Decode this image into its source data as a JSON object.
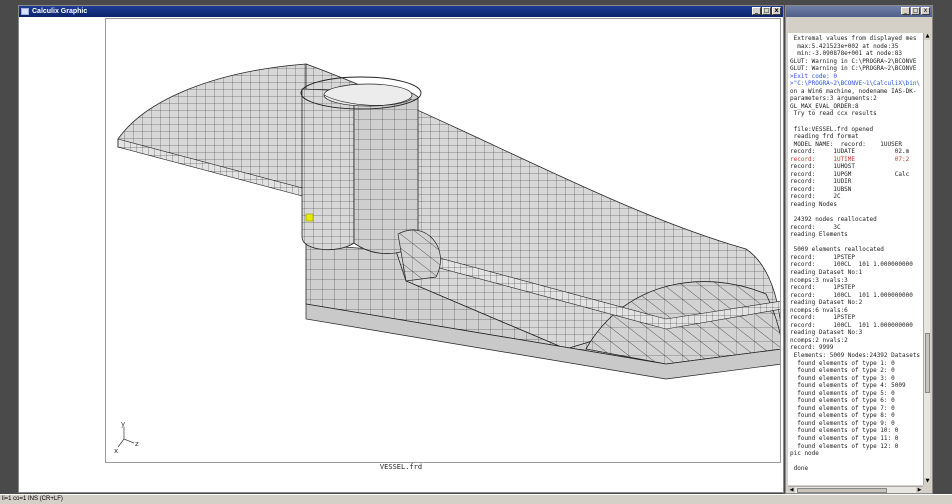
{
  "graphics_window": {
    "title": "Calculix Graphic",
    "caption": "VESSEL.frd",
    "buttons": {
      "minimize": "_",
      "maximize": "□",
      "close": "x"
    }
  },
  "axes_triad": {
    "y": "y",
    "z": "z",
    "x": "x"
  },
  "console_window": {
    "buttons": {
      "minimize": "_",
      "maximize": "□",
      "close": "x"
    },
    "lines": [
      {
        "text": " Extremal values from displayed mes",
        "style": ""
      },
      {
        "text": "  max:5.421523e+002 at node:35",
        "style": ""
      },
      {
        "text": "  min:-3.090878e+001 at node:83",
        "style": ""
      },
      {
        "text": "GLUT: Warning in C:\\PROGRA~2\\BCONVE",
        "style": ""
      },
      {
        "text": "GLUT: Warning in C:\\PROGRA~2\\BCONVE",
        "style": ""
      },
      {
        "text": ">Exit code: 0",
        "style": "blue"
      },
      {
        "text": ">\"C:\\PROGRA~2\\BCONVE~1\\CalculiX\\bin\\",
        "style": "blue"
      },
      {
        "text": "on a Win6 machine, nodename IAS-DK-",
        "style": ""
      },
      {
        "text": "parameters:3 arguments:2",
        "style": ""
      },
      {
        "text": "GL_MAX_EVAL_ORDER:8",
        "style": ""
      },
      {
        "text": " Try to read ccx results",
        "style": ""
      },
      {
        "text": "",
        "style": ""
      },
      {
        "text": " file:VESSEL.frd opened",
        "style": ""
      },
      {
        "text": " reading frd format",
        "style": ""
      },
      {
        "text": " MODEL NAME:  record:    1UUSER",
        "style": ""
      },
      {
        "text": "record:     1UDATE           02.m",
        "style": ""
      },
      {
        "text": "record:     1UTIME           07:2",
        "style": "red"
      },
      {
        "text": "record:     1UHOST",
        "style": ""
      },
      {
        "text": "record:     1UPGM            Calc",
        "style": ""
      },
      {
        "text": "record:     1UDIR",
        "style": ""
      },
      {
        "text": "record:     1UBSN",
        "style": ""
      },
      {
        "text": "record:     2C",
        "style": ""
      },
      {
        "text": "reading Nodes",
        "style": ""
      },
      {
        "text": "",
        "style": ""
      },
      {
        "text": " 24392 nodes reallocated",
        "style": ""
      },
      {
        "text": "record:     3C",
        "style": ""
      },
      {
        "text": "reading Elements",
        "style": ""
      },
      {
        "text": "",
        "style": ""
      },
      {
        "text": " 5009 elements reallocated",
        "style": ""
      },
      {
        "text": "record:     1PSTEP",
        "style": ""
      },
      {
        "text": "record:     100CL  101 1.000000000",
        "style": ""
      },
      {
        "text": "reading Dataset No:1",
        "style": ""
      },
      {
        "text": "ncomps:3 nvals:3",
        "style": ""
      },
      {
        "text": "record:     1PSTEP",
        "style": ""
      },
      {
        "text": "record:     100CL  101 1.000000000",
        "style": ""
      },
      {
        "text": "reading Dataset No:2",
        "style": ""
      },
      {
        "text": "ncomps:6 nvals:6",
        "style": ""
      },
      {
        "text": "record:     1PSTEP",
        "style": ""
      },
      {
        "text": "record:     100CL  101 1.000000000",
        "style": ""
      },
      {
        "text": "reading Dataset No:3",
        "style": ""
      },
      {
        "text": "ncomps:2 nvals:2",
        "style": ""
      },
      {
        "text": "record: 9999",
        "style": ""
      },
      {
        "text": " Elements: 5009 Nodes:24392 Datasets",
        "style": ""
      },
      {
        "text": "  found elements of type 1: 0",
        "style": ""
      },
      {
        "text": "  found elements of type 2: 0",
        "style": ""
      },
      {
        "text": "  found elements of type 3: 0",
        "style": ""
      },
      {
        "text": "  found elements of type 4: 5009",
        "style": ""
      },
      {
        "text": "  found elements of type 5: 0",
        "style": ""
      },
      {
        "text": "  found elements of type 6: 0",
        "style": ""
      },
      {
        "text": "  found elements of type 7: 0",
        "style": ""
      },
      {
        "text": "  found elements of type 8: 0",
        "style": ""
      },
      {
        "text": "  found elements of type 9: 0",
        "style": ""
      },
      {
        "text": "  found elements of type 10: 0",
        "style": ""
      },
      {
        "text": "  found elements of type 11: 0",
        "style": ""
      },
      {
        "text": "  found elements of type 12: 0",
        "style": ""
      },
      {
        "text": "pic node",
        "style": ""
      },
      {
        "text": "",
        "style": ""
      },
      {
        "text": " done",
        "style": ""
      }
    ]
  },
  "status_bar": {
    "text": "li=1 co=1 INS (CR+LF)"
  },
  "colors": {
    "title_bar": "#0a246a",
    "mesh_face": "#d6d6d6",
    "mesh_line": "#2a2a2a",
    "console_red": "#c0392b",
    "console_blue": "#2a52d8",
    "pick_marker": "#e8e800"
  }
}
